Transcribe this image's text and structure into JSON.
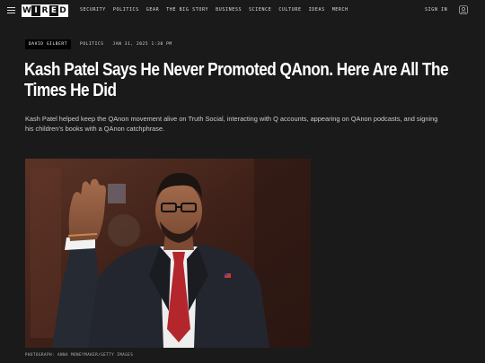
{
  "header": {
    "logo_letters": [
      "W",
      "I",
      "R",
      "E",
      "D"
    ],
    "nav": [
      "SECURITY",
      "POLITICS",
      "GEAR",
      "THE BIG STORY",
      "BUSINESS",
      "SCIENCE",
      "CULTURE",
      "IDEAS",
      "MERCH"
    ],
    "sign_in": "SIGN IN"
  },
  "article": {
    "author": "DAVID GILBERT",
    "category": "POLITICS",
    "date": "JAN 31, 2025 1:30 PM",
    "title": "Kash Patel Says He Never Promoted QAnon. Here Are All The Times He Did",
    "dek": "Kash Patel helped keep the QAnon movement alive on Truth Social, interacting with Q accounts, appearing on QAnon podcasts, and signing his children’s books with a QAnon catchphrase.",
    "photo_credit": "PHOTOGRAPH: ANNA MONEYMAKER/GETTY IMAGES"
  },
  "colors": {
    "background": "#1a1a1a",
    "tie": "#b3262b",
    "suit": "#23262e"
  }
}
